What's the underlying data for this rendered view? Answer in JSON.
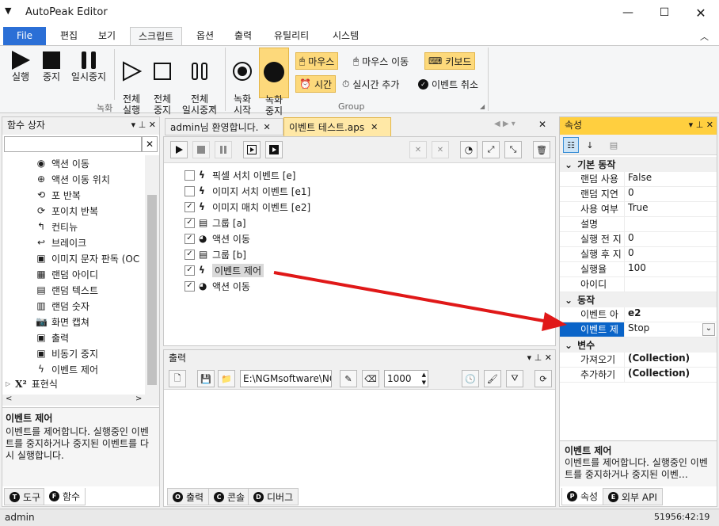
{
  "window": {
    "title": "AutoPeak Editor"
  },
  "ribbon_tabs": [
    "File",
    "편집",
    "보기",
    "스크립트",
    "옵션",
    "출력",
    "유틸리티",
    "시스템"
  ],
  "ribbon": {
    "record_group": {
      "label": "녹화",
      "buttons": [
        "실행",
        "중지",
        "일시중지",
        "전체\n실행",
        "전체\n중지",
        "전체\n일시중지"
      ]
    },
    "group2": {
      "label": "Group",
      "rec_start": "녹화\n시작",
      "rec_stop": "녹화\n중지",
      "mouse": "마우스",
      "mouse_move": "마우스 이동",
      "keyboard": "키보드",
      "time": "시간",
      "realtime_add": "실시간 추가",
      "event_cancel": "이벤트 취소"
    }
  },
  "func_panel": {
    "title": "함수 상자",
    "items": [
      "액션 이동",
      "액션 이동 위치",
      "포 반복",
      "포이치 반복",
      "컨티뉴",
      "브레이크",
      "이미지 문자 판독 (OC",
      "랜덤 아이디",
      "랜덤 텍스트",
      "랜덤 숫자",
      "화면 캡쳐",
      "출력",
      "비동기 중지",
      "이벤트 제어"
    ],
    "group_item": "표현식",
    "desc_title": "이벤트 제어",
    "desc_text": "이벤트를 제어합니다. 실행중인 이벤트를 중지하거나 중지된 이벤트를 다시 실행합니다.",
    "tabs": [
      "도구",
      "함수"
    ]
  },
  "doc_tabs": [
    "admin님 환영합니다.",
    "이벤트 테스트.aps"
  ],
  "events": [
    {
      "label": "픽셀 서치 이벤트 [e]",
      "checked": false,
      "icon": "bolt"
    },
    {
      "label": "이미지 서치 이벤트 [e1]",
      "checked": false,
      "icon": "bolt"
    },
    {
      "label": "이미지 매치 이벤트 [e2]",
      "checked": true,
      "icon": "bolt"
    },
    {
      "label": "그룹 [a]",
      "checked": true,
      "icon": "group"
    },
    {
      "label": "액션 이동",
      "checked": true,
      "icon": "action"
    },
    {
      "label": "그룹 [b]",
      "checked": true,
      "icon": "group"
    },
    {
      "label": "이벤트 제어",
      "checked": true,
      "icon": "bolt"
    },
    {
      "label": "액션 이동",
      "checked": true,
      "icon": "action"
    }
  ],
  "output_panel": {
    "title": "출력",
    "path": "E:\\NGMsoftware\\NG",
    "count": "1000",
    "tabs": [
      "출력",
      "콘솔",
      "디버그"
    ]
  },
  "properties": {
    "title": "속성",
    "cat_basic": "기본 동작",
    "basic_rows": [
      {
        "k": "랜덤 사용",
        "v": "False"
      },
      {
        "k": "랜덤 지연",
        "v": "0"
      },
      {
        "k": "사용 여부",
        "v": "True"
      },
      {
        "k": "설명",
        "v": ""
      },
      {
        "k": "실행 전 지",
        "v": "0"
      },
      {
        "k": "실행 후 지",
        "v": "0"
      },
      {
        "k": "실행율",
        "v": "100"
      },
      {
        "k": "아이디",
        "v": ""
      }
    ],
    "cat_action": "동작",
    "action_rows": [
      {
        "k": "이벤트 아",
        "v": "e2"
      },
      {
        "k": "이벤트 제",
        "v": "Stop"
      }
    ],
    "cat_var": "변수",
    "var_rows": [
      {
        "k": "가져오기",
        "v": "(Collection)"
      },
      {
        "k": "추가하기",
        "v": "(Collection)"
      }
    ],
    "desc_title": "이벤트 제어",
    "desc_text": "이벤트를 제어합니다. 실행중인 이벤트를 중지하거나 중지된 이벤…",
    "tabs": [
      "속성",
      "외부 API"
    ]
  },
  "status": {
    "user": "admin",
    "time": "51956:42:19"
  },
  "colors": {
    "accent": "#2b6fd6",
    "highlight": "#fdd97b",
    "arrow": "#e01818"
  }
}
